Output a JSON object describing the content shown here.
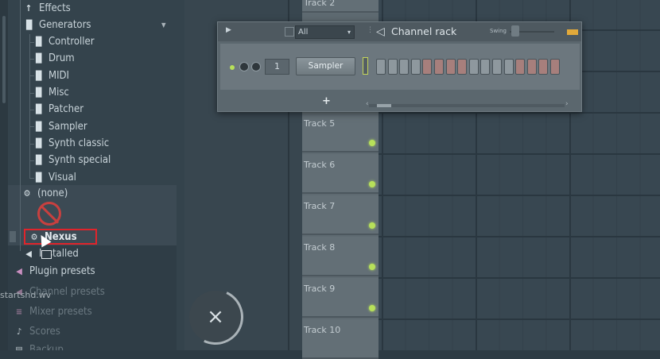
{
  "browser": {
    "items": [
      {
        "label": "Effects",
        "icon": "plug-icon"
      },
      {
        "label": "Generators",
        "icon": "piano-icon"
      },
      {
        "label": "Controller",
        "icon": "piano-icon"
      },
      {
        "label": "Drum",
        "icon": "piano-icon"
      },
      {
        "label": "MIDI",
        "icon": "piano-icon"
      },
      {
        "label": "Misc",
        "icon": "piano-icon"
      },
      {
        "label": "Patcher",
        "icon": "piano-icon"
      },
      {
        "label": "Sampler",
        "icon": "piano-icon"
      },
      {
        "label": "Synth classic",
        "icon": "piano-icon"
      },
      {
        "label": "Synth special",
        "icon": "piano-icon"
      },
      {
        "label": "Visual",
        "icon": "piano-icon"
      },
      {
        "label": "(none)",
        "icon": "gear-icon"
      },
      {
        "label": "Nexus",
        "icon": "gear-icon"
      },
      {
        "label": "Installed",
        "icon": "speaker-icon"
      },
      {
        "label": "Plugin presets",
        "icon": "plug-icon"
      },
      {
        "label": "Channel presets",
        "icon": "plug-icon"
      },
      {
        "label": "Mixer presets",
        "icon": "mixer-icon"
      },
      {
        "label": "Scores",
        "icon": "note-icon"
      },
      {
        "label": "Backup",
        "icon": "folder-icon"
      }
    ],
    "drag_filename": "startshd.wv",
    "highlight_color": "#e0242b"
  },
  "playlist": {
    "tracks": [
      "Track 2",
      "Track 5",
      "Track 6",
      "Track 7",
      "Track 8",
      "Track 9",
      "Track 10"
    ]
  },
  "channel_rack": {
    "filter": "All",
    "title": "Channel rack",
    "swing_label": "Swing",
    "channel_number": "1",
    "channel_name": "Sampler",
    "add_label": "+",
    "steps": 16
  },
  "close_label": "×"
}
